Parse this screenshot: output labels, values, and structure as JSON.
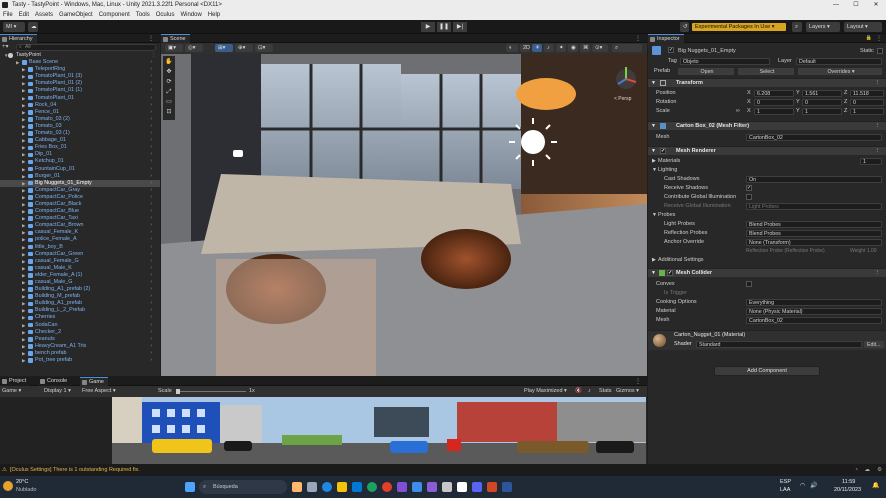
{
  "window": {
    "title": "Tasty - TastyPoint - Windows, Mac, Linux - Unity 2021.3.22f1 Personal <DX11>",
    "minimize": "—",
    "maximize": "☐",
    "close": "✕"
  },
  "menu": [
    "File",
    "Edit",
    "Assets",
    "GameObject",
    "Component",
    "Tools",
    "Oculus",
    "Window",
    "Help"
  ],
  "toolbar": {
    "account": "MI",
    "experimental": "Experimental Packages In Use",
    "layers": "Layers",
    "layout": "Layout"
  },
  "hierarchy": {
    "tab": "Hierarchy",
    "search_placeholder": "All",
    "scene_name": "TastyPoint",
    "items": [
      "Base Scene",
      "TeleportRing",
      "TomatoPlant_01 (3)",
      "TomatoPlant_01 (2)",
      "TomatoPlant_01 (1)",
      "TomatoPlant_01",
      "Rock_04",
      "Fence_01",
      "Tomato_03 (2)",
      "Tomato_03",
      "Tomato_03 (1)",
      "Cabbage_01",
      "Fries Box_01",
      "Dip_01",
      "Ketchup_01",
      "FountainCup_01",
      "Burger_01",
      "Big Nuggets_01_Empty",
      "CompactCar_Gray",
      "CompactCar_Police",
      "CompactCar_Black",
      "CompactCar_Blue",
      "CompactCar_Taxi",
      "CompactCar_Brown",
      "casual_Female_K",
      "police_Female_A",
      "little_boy_B",
      "CompactCar_Green",
      "casual_Female_G",
      "casual_Male_K",
      "elder_Female_A (1)",
      "casual_Male_G",
      "Building_A1_prefab (2)",
      "Building_M_prefab",
      "Building_A1_prefab",
      "Building_L_2_Prefab",
      "Cherries",
      "SodaCan",
      "Checker_2",
      "Peanuts",
      "HeavyCream_A1 Tris",
      "bench prefab",
      "Pot_tree prefab"
    ],
    "selected": "Big Nuggets_01_Empty"
  },
  "scene": {
    "tab": "Scene",
    "persp": "< Persp"
  },
  "game": {
    "tabs": [
      "Project",
      "Console",
      "Game"
    ],
    "mode": "Game",
    "display": "Display 1",
    "aspect": "Free Aspect",
    "scale_label": "Scale",
    "scale_value": "1x",
    "play_mode": "Play Maximized",
    "stats": "Stats",
    "gizmos": "Gizmos"
  },
  "inspector": {
    "tab": "Inspector",
    "object_name": "Big Nuggets_01_Empty",
    "static_label": "Static",
    "tag_label": "Tag",
    "tag_value": "Objeto",
    "layer_label": "Layer",
    "layer_value": "Default",
    "prefab_label": "Prefab",
    "prefab_open": "Open",
    "prefab_select": "Select",
    "prefab_overrides": "Overrides",
    "transform": {
      "title": "Transform",
      "rows": [
        {
          "label": "Position",
          "x": "6.208",
          "y": "1.561",
          "z": "11.518"
        },
        {
          "label": "Rotation",
          "x": "0",
          "y": "0",
          "z": "0"
        },
        {
          "label": "Scale",
          "x": "1",
          "y": "1",
          "z": "1"
        }
      ]
    },
    "mesh_filter": {
      "title": "Carton Box_02 (Mesh Filter)",
      "mesh_label": "Mesh",
      "mesh_value": "CartonBox_02"
    },
    "mesh_renderer": {
      "title": "Mesh Renderer",
      "materials_label": "Materials",
      "materials_count": "1",
      "lighting_label": "Lighting",
      "cast_shadows_label": "Cast Shadows",
      "cast_shadows_value": "On",
      "receive_shadows_label": "Receive Shadows",
      "contribute_gi_label": "Contribute Global Illumination",
      "receive_gi_label": "Receive Global Illumination",
      "receive_gi_value": "Light Probes",
      "probes_label": "Probes",
      "light_probes_label": "Light Probes",
      "light_probes_value": "Blend Probes",
      "reflection_probes_label": "Reflection Probes",
      "reflection_probes_value": "Blend Probes",
      "anchor_label": "Anchor Override",
      "anchor_value": "None (Transform)",
      "ref_probe_line": "Reflection Probe (Reflection Probe)",
      "weight_label": "Weight 1.00",
      "additional_label": "Additional Settings"
    },
    "mesh_collider": {
      "title": "Mesh Collider",
      "convex_label": "Convex",
      "is_trigger_label": "Is Trigger",
      "cooking_label": "Cooking Options",
      "cooking_value": "Everything",
      "material_label": "Material",
      "material_value": "None (Physic Material)",
      "mesh_label": "Mesh",
      "mesh_value": "CartonBox_02"
    },
    "material": {
      "title": "Carton_Nugget_01 (Material)",
      "shader_label": "Shader",
      "shader_value": "Standard",
      "edit_label": "Edit..."
    },
    "add_component": "Add Component"
  },
  "status": {
    "message": "[Oculus Settings] There is 1 outstanding Required fix."
  },
  "taskbar": {
    "weather_temp": "20°C",
    "weather_desc": "Nublado",
    "search_placeholder": "Búsqueda",
    "lang": "ESP",
    "lang2": "LAA",
    "time": "11:59",
    "date": "20/11/2023"
  },
  "colors": {
    "accent": "#4a90d9",
    "experimental": "#d9a520",
    "hierarchy_text": "#7fb2ee",
    "status_warning": "#e2b84a"
  }
}
